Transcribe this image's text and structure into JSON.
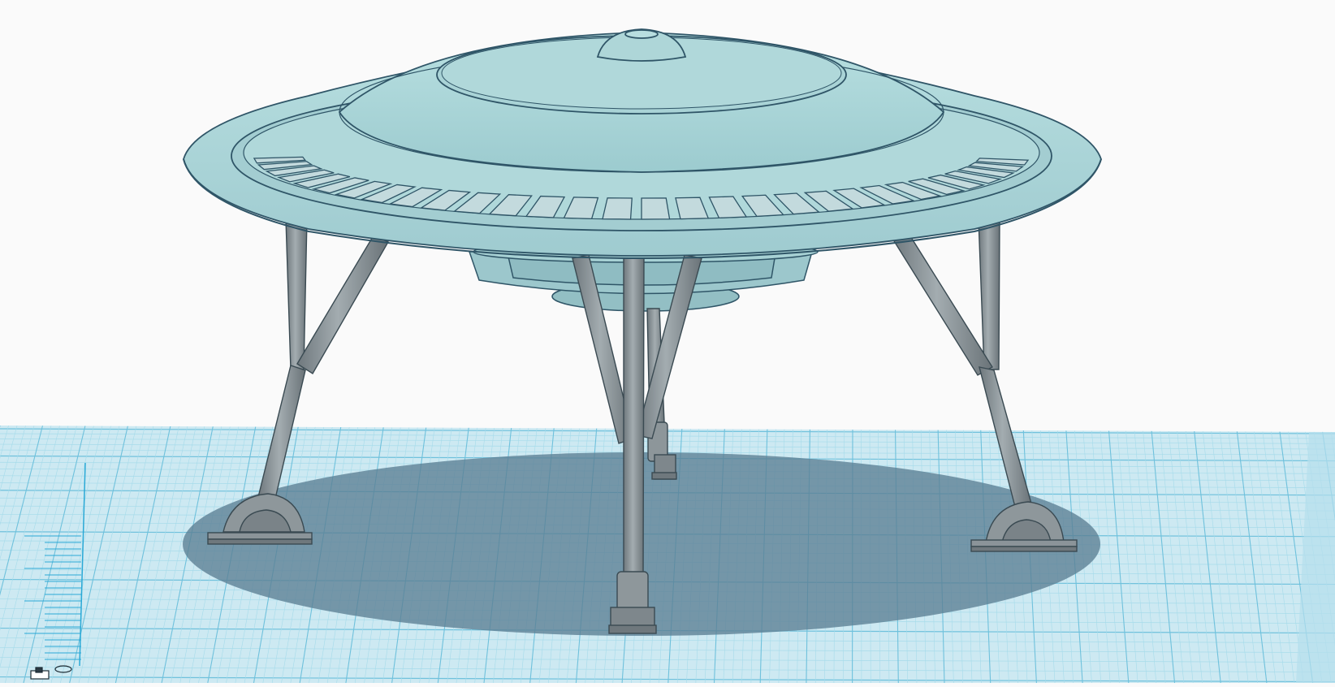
{
  "app": {
    "view": "3d-workplane-viewport",
    "object": "ufo-lander-model"
  },
  "colors": {
    "background": "#fafafa",
    "workplane": "#c9e6f0",
    "grid_major": "#6fc1dc",
    "grid_minor": "#a6dbea",
    "shadow": "#6e8fa0",
    "hull": "#a9d3d6",
    "hull_light": "#b5dddd",
    "hull_shade": "#8fb7bd",
    "panel": "#c3dadd",
    "outline": "#2f5567",
    "legs": "#8b9499",
    "legs_dark": "#6d767b",
    "ruler": "#2aa9d6"
  },
  "icons": {
    "view_cube": "origin-marker-icon"
  }
}
